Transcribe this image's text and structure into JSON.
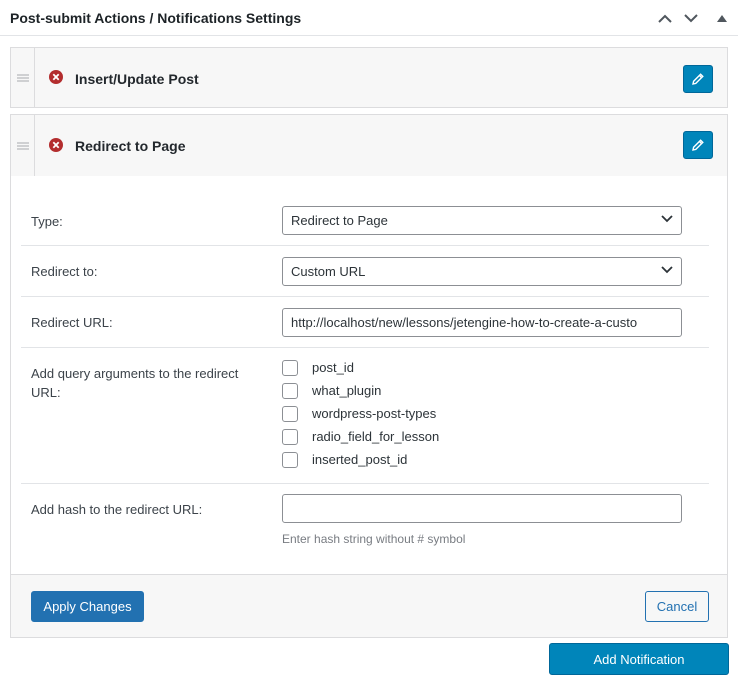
{
  "header": {
    "title": "Post-submit Actions / Notifications Settings",
    "controls": [
      "chevron-up-icon",
      "chevron-down-icon",
      "triangle-up-icon"
    ]
  },
  "actions": [
    {
      "title": "Insert/Update Post",
      "remove_icon": "remove-circle-icon",
      "edit_icon": "pencil-icon"
    },
    {
      "title": "Redirect to Page",
      "remove_icon": "remove-circle-icon",
      "edit_icon": "pencil-icon"
    }
  ],
  "editor": {
    "type": {
      "label": "Type:",
      "value": "Redirect to Page"
    },
    "redirect_to": {
      "label": "Redirect to:",
      "value": "Custom URL"
    },
    "redirect_url": {
      "label": "Redirect URL:",
      "value": "http://localhost/new/lessons/jetengine-how-to-create-a-custo"
    },
    "query_args": {
      "label": "Add query arguments to the redirect URL:",
      "options": [
        {
          "label": "post_id",
          "checked": false
        },
        {
          "label": "what_plugin",
          "checked": false
        },
        {
          "label": "wordpress-post-types",
          "checked": false
        },
        {
          "label": "radio_field_for_lesson",
          "checked": false
        },
        {
          "label": "inserted_post_id",
          "checked": false
        }
      ]
    },
    "hash": {
      "label": "Add hash to the redirect URL:",
      "value": "",
      "hint": "Enter hash string without # symbol"
    }
  },
  "footer": {
    "apply_label": "Apply Changes",
    "cancel_label": "Cancel"
  },
  "add_notification_label": "Add Notification",
  "colors": {
    "primary": "#2271b1",
    "edit_button": "#0085ba",
    "remove_icon": "#b32d2e"
  }
}
